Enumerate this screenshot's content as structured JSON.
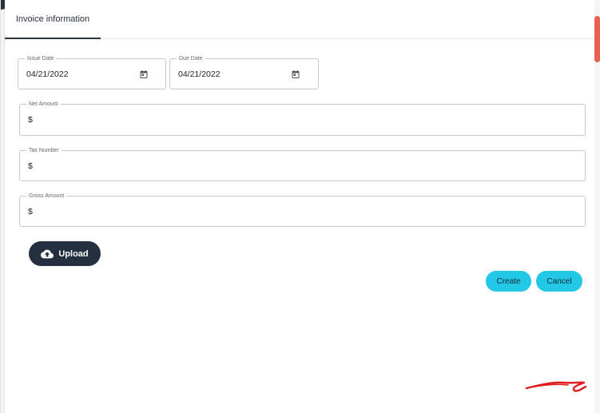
{
  "tabs": [
    {
      "label": "Invoice information"
    }
  ],
  "form": {
    "issue_date": {
      "label": "Issue Date",
      "value": "04/21/2022"
    },
    "due_date": {
      "label": "Due Date",
      "value": "04/21/2022"
    },
    "net_amount": {
      "label": "Net Amount",
      "value": "$"
    },
    "tax_number": {
      "label": "Tax Number",
      "value": "$"
    },
    "gross_amount": {
      "label": "Gross Amount",
      "value": "$"
    }
  },
  "buttons": {
    "upload": "Upload",
    "create": "Create",
    "cancel": "Cancel"
  },
  "colors": {
    "dark": "#243040",
    "accent": "#22c8e5",
    "scroll_thumb": "#e8604f",
    "signature": "#e01b1b"
  },
  "icons": [
    "calendar-icon",
    "cloud-upload-icon"
  ]
}
